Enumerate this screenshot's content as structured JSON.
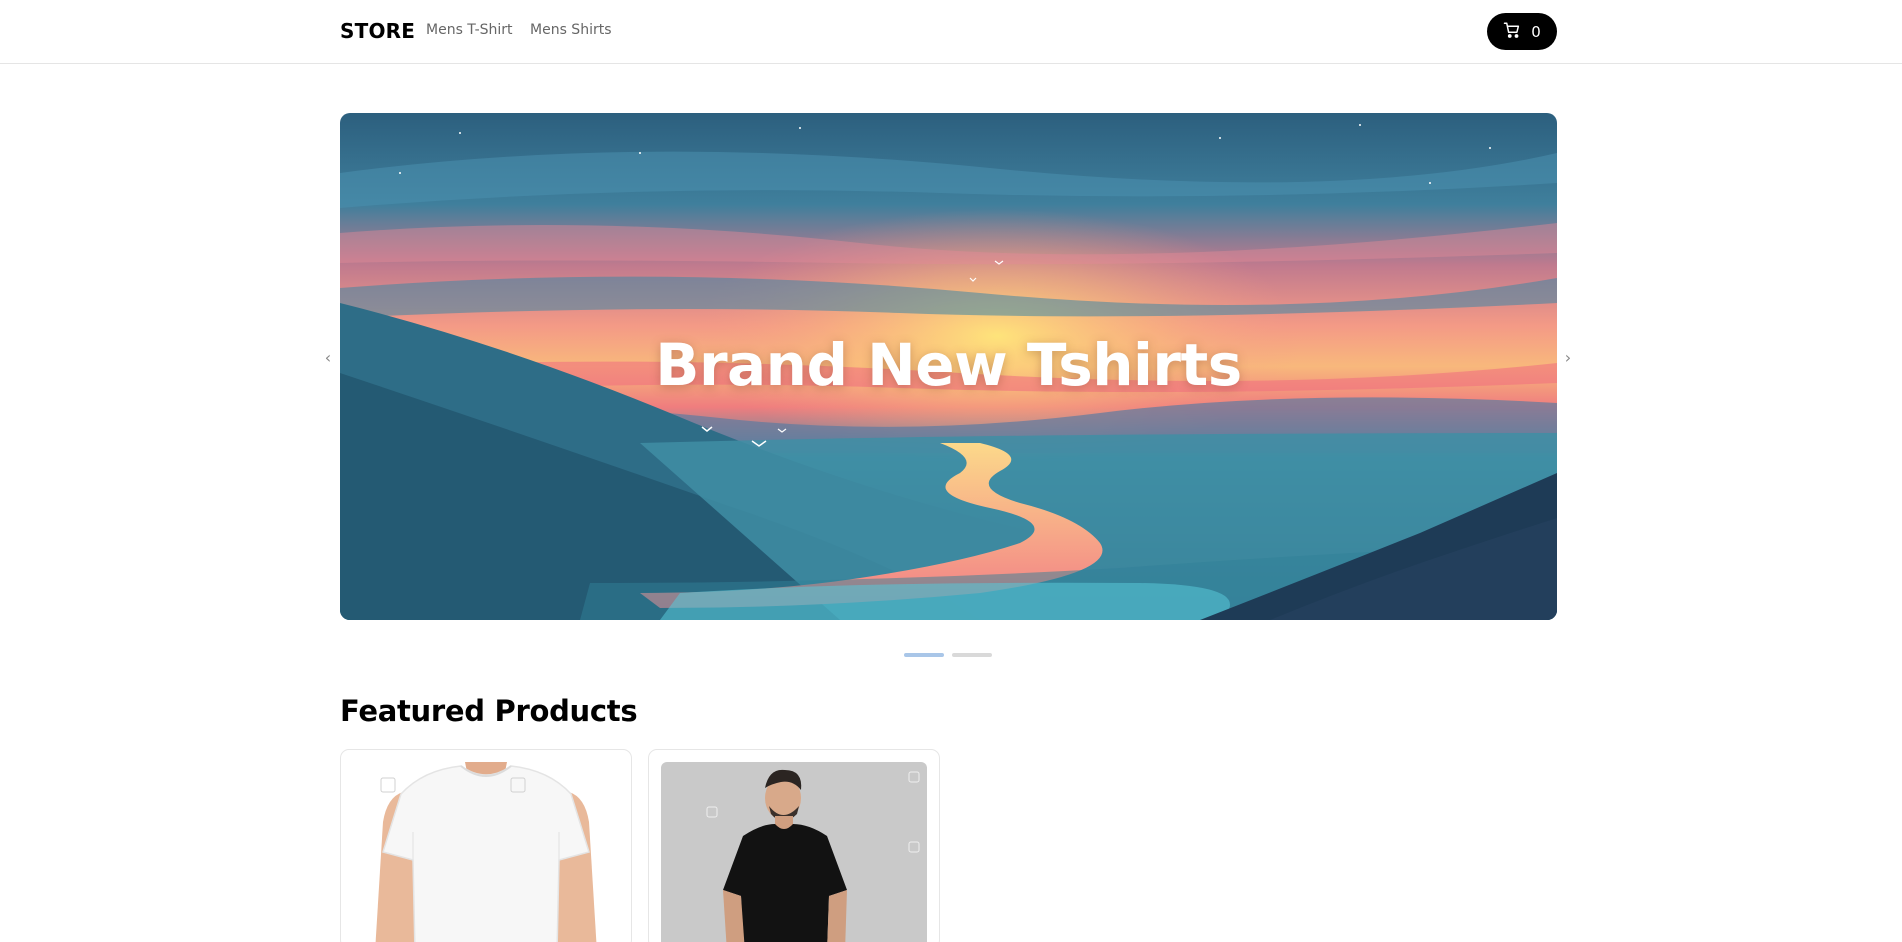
{
  "nav": {
    "brand": "STORE",
    "links": [
      "Mens T-Shirt",
      "Mens Shirts"
    ],
    "cart_count": "0",
    "cart_icon": "cart-icon"
  },
  "carousel": {
    "slide_title": "Brand New Tshirts",
    "prev_icon": "chevron-left-icon",
    "next_icon": "chevron-right-icon",
    "slide_count": 2,
    "active_slide": 1
  },
  "featured": {
    "title": "Featured Products",
    "products": [
      {
        "image": "white-tshirt-photo"
      },
      {
        "image": "black-tshirt-photo"
      }
    ]
  },
  "colors": {
    "primary": "#000000",
    "nav_link": "#666666",
    "active_dot": "#a9c6e8",
    "inactive_dot": "#d9d9d9"
  }
}
